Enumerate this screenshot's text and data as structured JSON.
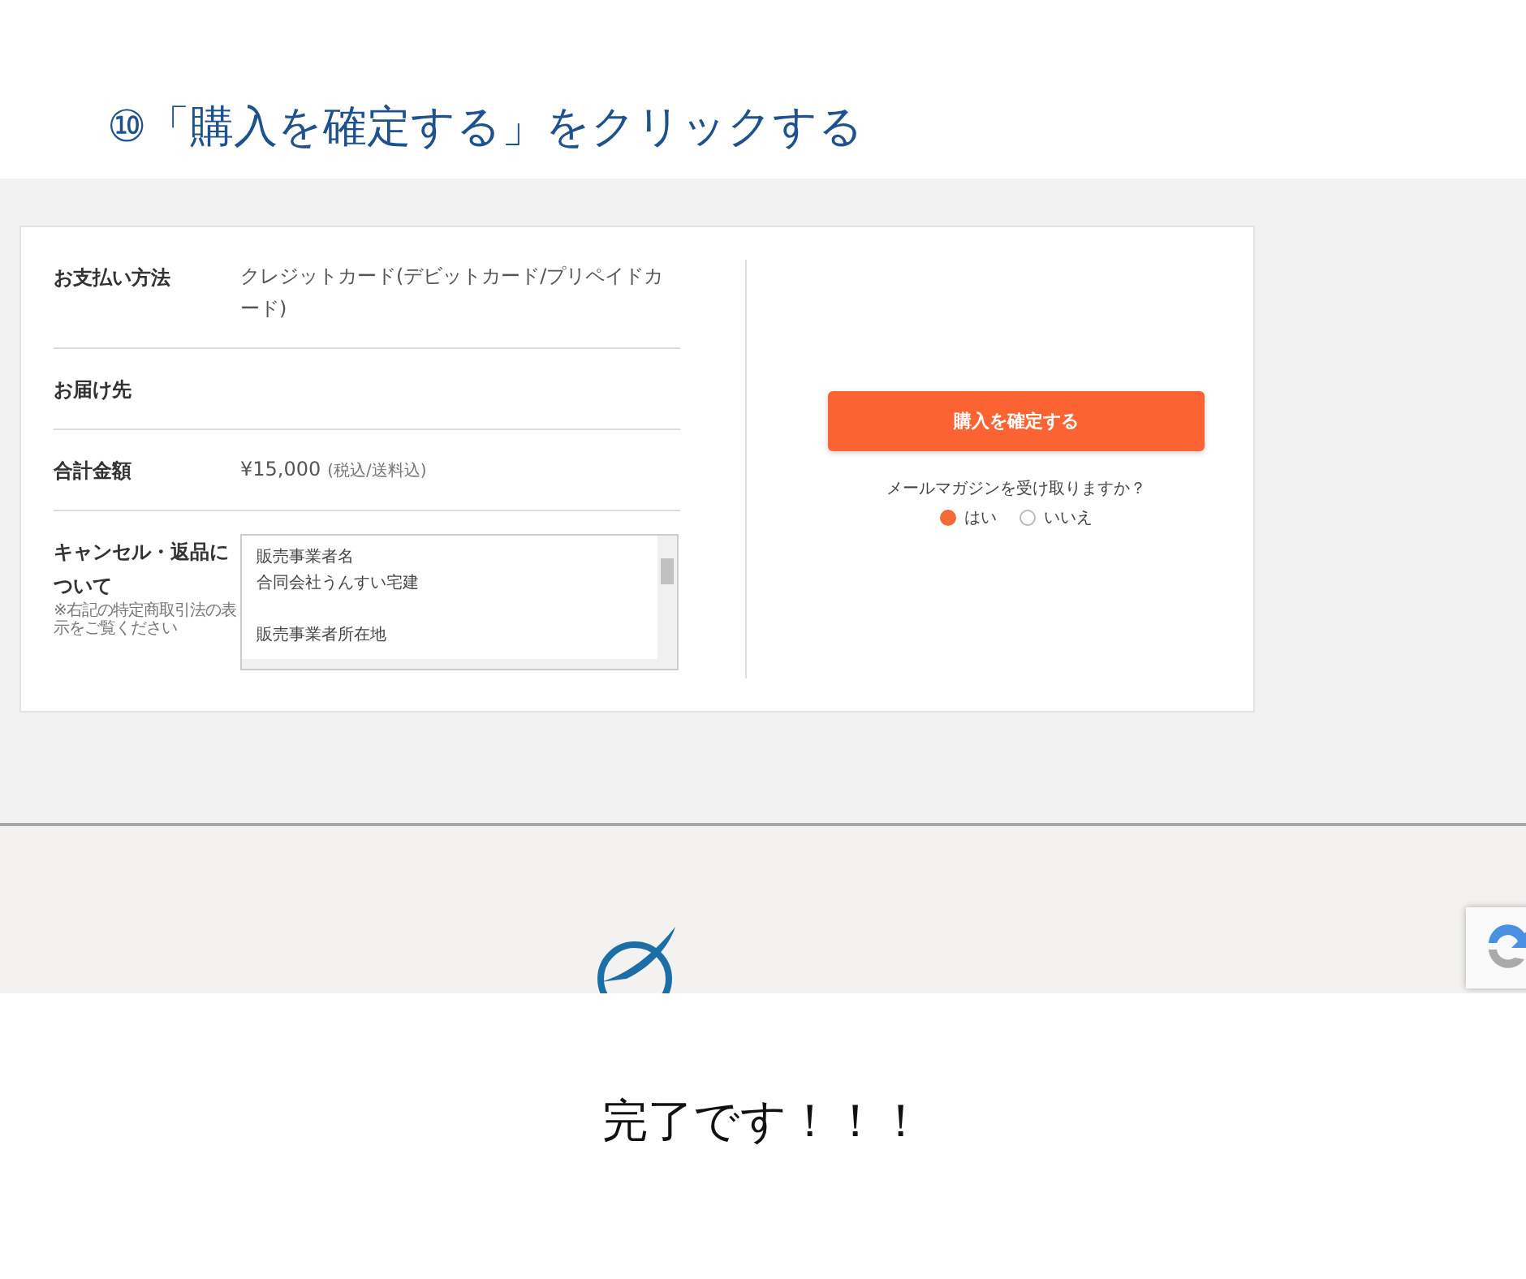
{
  "heading": "⑩「購入を確定する」をクリックする",
  "order": {
    "rows": [
      {
        "kind": "text",
        "label": "お支払い方法",
        "value": "クレジットカード(デビットカード/プリペイドカード)"
      },
      {
        "kind": "text",
        "label": "お届け先"
      },
      {
        "kind": "price",
        "label": "合計金額",
        "value": "¥15,000",
        "tax_note": "(税込/送料込)"
      },
      {
        "kind": "textarea",
        "label": "キャンセル・返品について",
        "note": "※右記の特定商取引法の表示をご覧ください",
        "paragraphs": [
          [
            "販売事業者名",
            "合同会社うんすい宅建"
          ],
          [
            "販売事業者所在地"
          ]
        ]
      }
    ],
    "confirm_button": "購入を確定する",
    "newsletter": {
      "question": "メールマガジンを受け取りますか？",
      "options": [
        {
          "label": "はい",
          "selected": true
        },
        {
          "label": "いいえ",
          "selected": false
        }
      ]
    }
  },
  "caption": "完了です！！！"
}
